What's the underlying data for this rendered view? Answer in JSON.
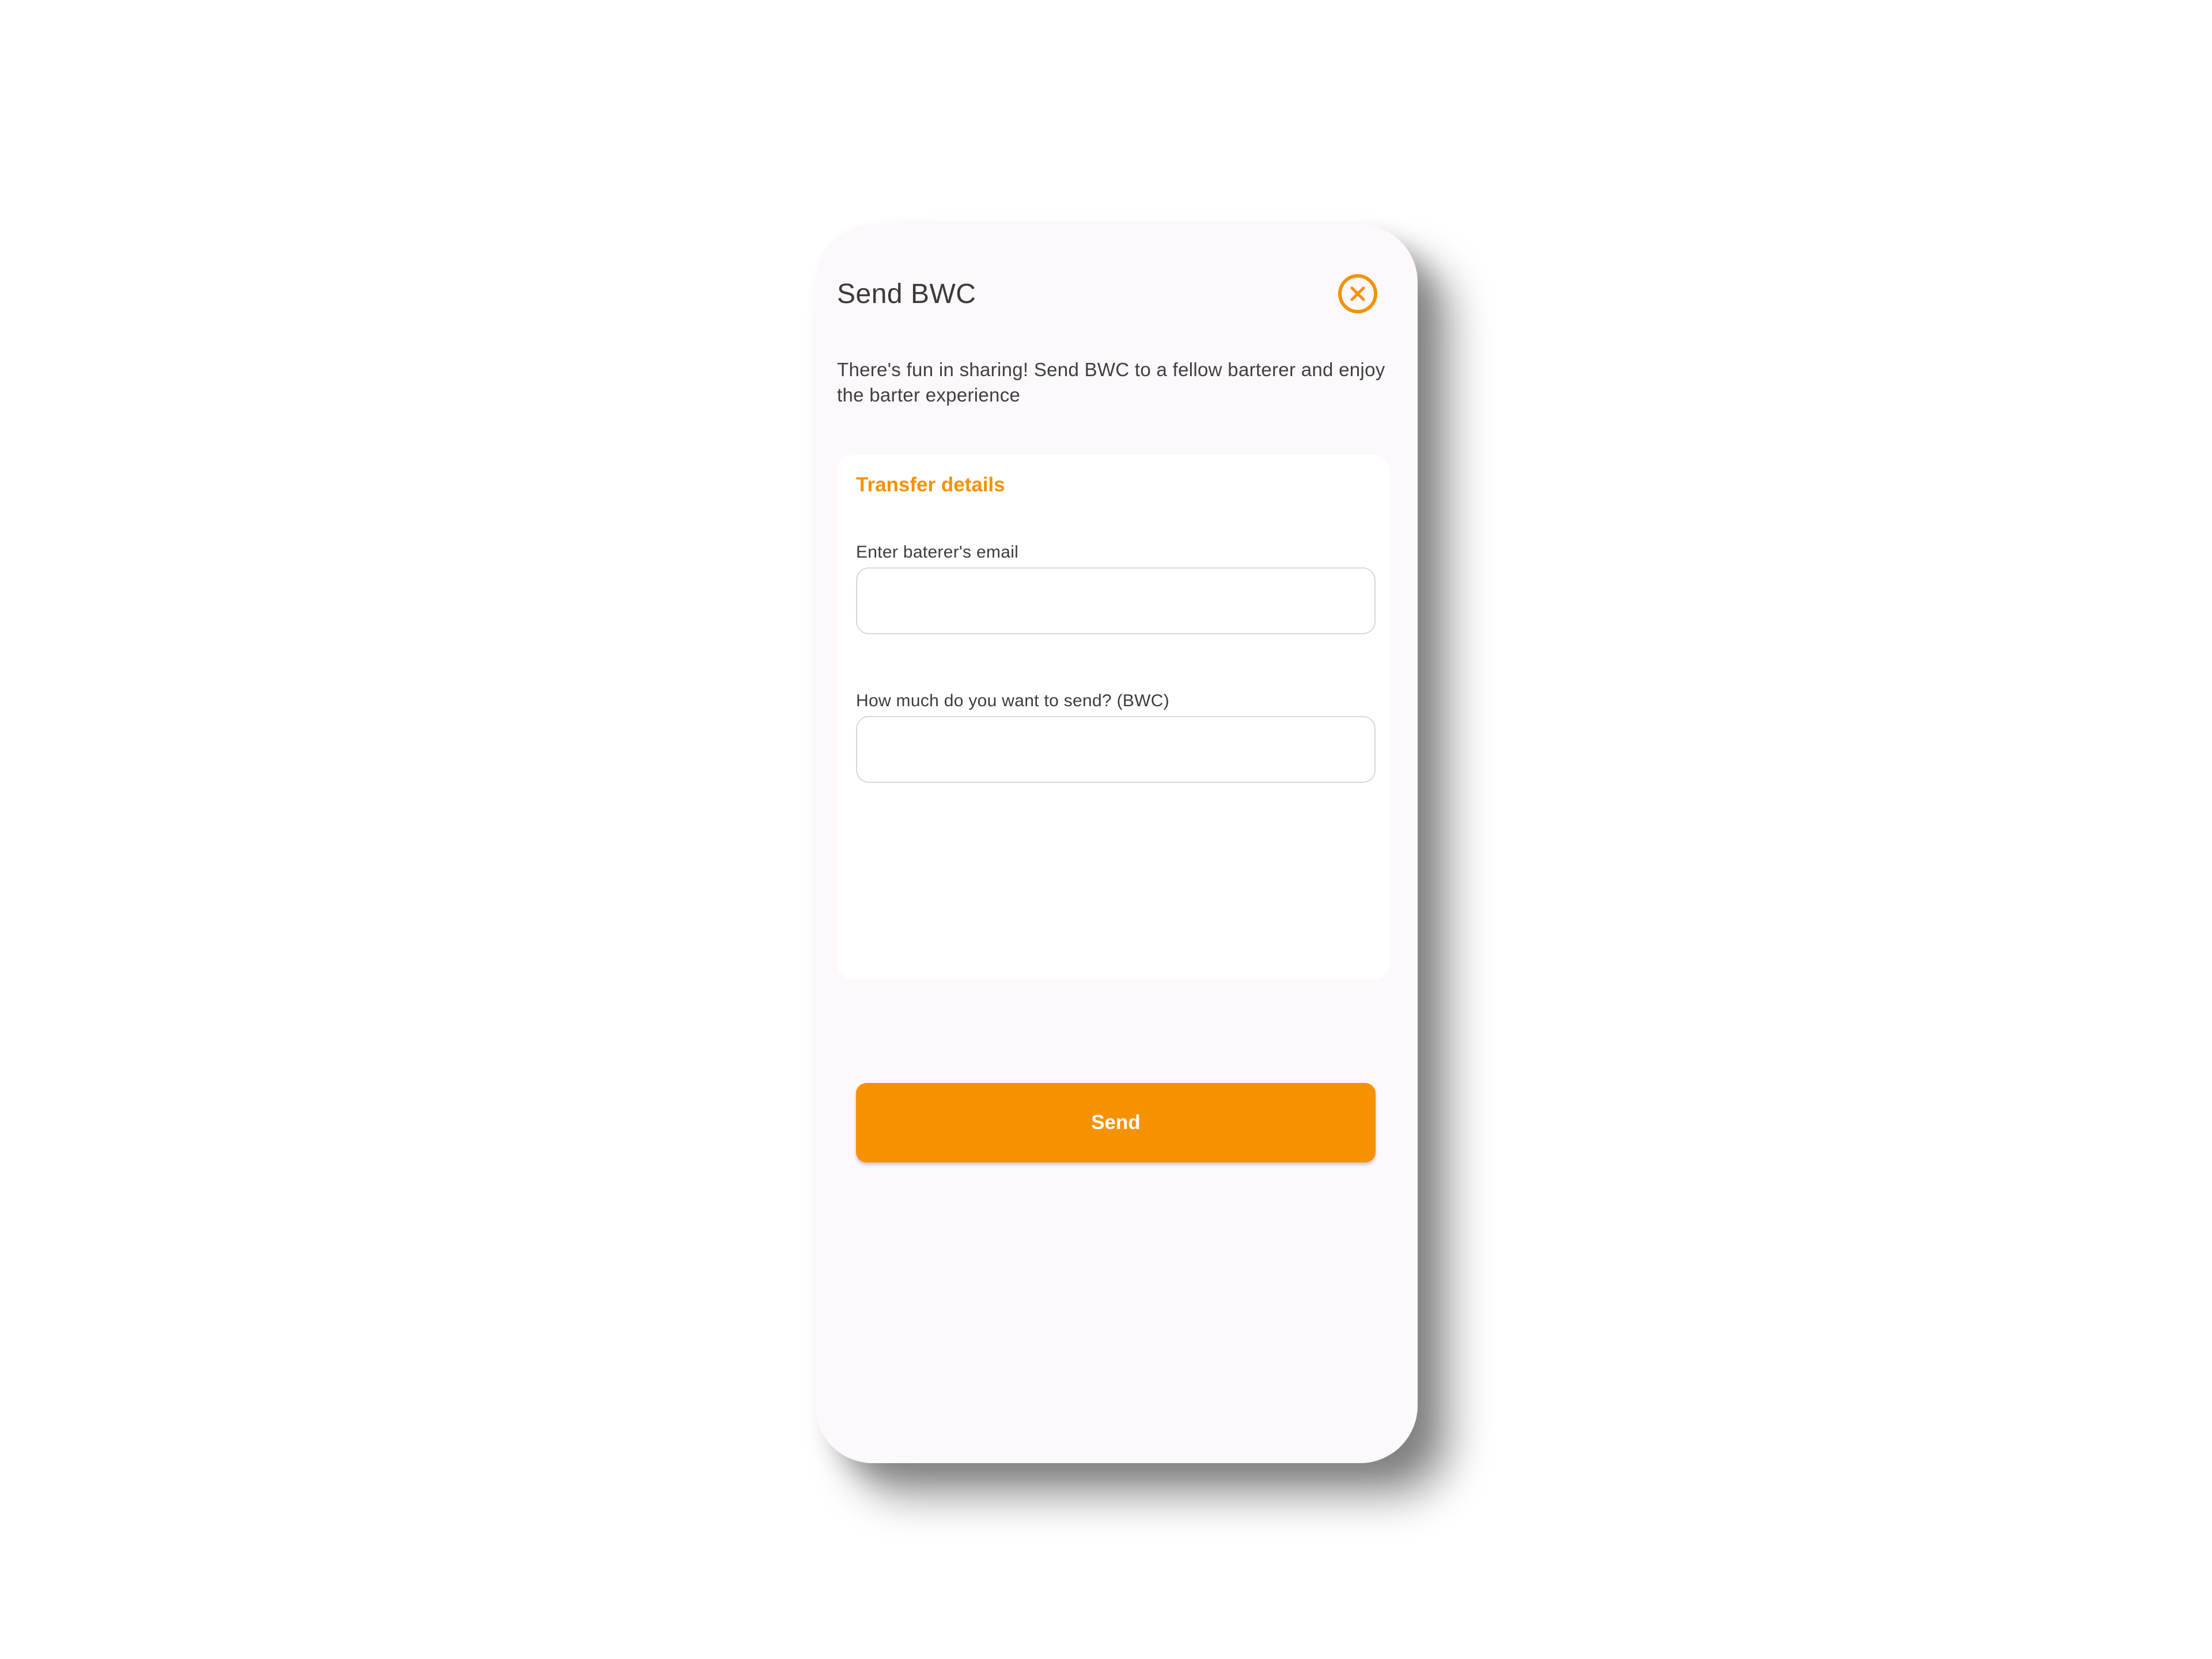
{
  "modal": {
    "title": "Send BWC",
    "close_icon": "close-circle-icon",
    "description": "There's fun in sharing! Send BWC to a fellow barterer and enjoy the barter experience"
  },
  "transfer": {
    "section_title": "Transfer details",
    "email": {
      "label": "Enter baterer's email",
      "value": "",
      "placeholder": ""
    },
    "amount": {
      "label": "How much do you want to send? (BWC)",
      "value": "",
      "placeholder": ""
    },
    "send_label": "Send"
  },
  "colors": {
    "accent": "#f39200",
    "button": "#f69200",
    "modal_bg": "#fdf8fb"
  }
}
